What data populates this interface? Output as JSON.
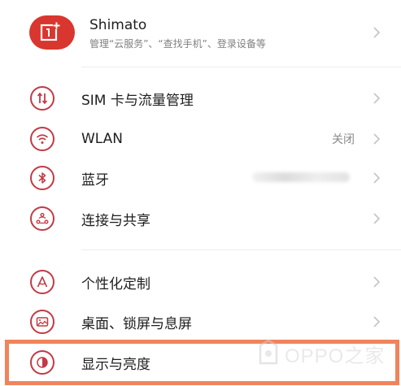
{
  "account": {
    "name": "Shimato",
    "subtitle": "管理“云服务”、“查找手机”、登录设备等",
    "logo_icon": "oneplus-logo-icon"
  },
  "settings": {
    "items": [
      {
        "label": "SIM 卡与流量管理",
        "icon": "sim-card-icon",
        "value": ""
      },
      {
        "label": "WLAN",
        "icon": "wifi-icon",
        "value": "关闭"
      },
      {
        "label": "蓝牙",
        "icon": "bluetooth-icon",
        "value": ""
      },
      {
        "label": "连接与共享",
        "icon": "share-icon",
        "value": ""
      },
      {
        "label": "个性化定制",
        "icon": "personalize-icon",
        "value": ""
      },
      {
        "label": "桌面、锁屏与息屏",
        "icon": "wallpaper-icon",
        "value": ""
      },
      {
        "label": "显示与亮度",
        "icon": "display-brightness-icon",
        "value": ""
      }
    ]
  },
  "watermark": {
    "text": "OPPO之家"
  },
  "colors": {
    "accent": "#c23a45",
    "logo_red": "#d9362f",
    "highlight": "#f0845b"
  }
}
